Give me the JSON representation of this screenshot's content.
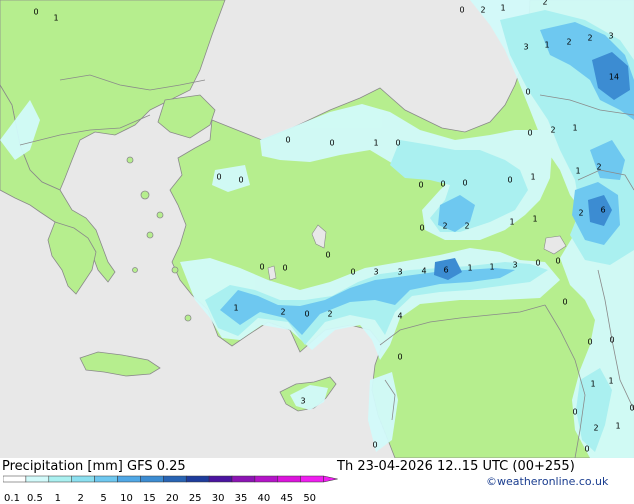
{
  "footer": {
    "title": "Precipitation [mm]  GFS 0.25",
    "valid": "Th 23-04-2026 12..15 UTC (00+255)",
    "credit": "©weatheronline.co.uk"
  },
  "legend": {
    "labels": [
      "0.1",
      "0.5",
      "1",
      "2",
      "5",
      "10",
      "15",
      "20",
      "25",
      "30",
      "35",
      "40",
      "45",
      "50"
    ],
    "colors": [
      "#ffffff",
      "#d2fafa",
      "#aaf0f0",
      "#8ce0f0",
      "#6ec8f0",
      "#50a8e6",
      "#3c8cd2",
      "#2864b4",
      "#1e3c9c",
      "#4b14a0",
      "#8c14b4",
      "#b414c8",
      "#dc14dc",
      "#f01ef0"
    ]
  },
  "map_colors": {
    "sea": "#e8e8e8",
    "land": "#b6ee8e",
    "border": "#8a8a8a",
    "precip_light": "#d2fafa",
    "precip_medium": "#aaf0f0",
    "precip_heavy": "#6ec8f0",
    "precip_max": "#3c8cd2"
  },
  "map_values": {
    "a0": "0",
    "a1": "1",
    "b0": "0",
    "b1": "2",
    "b2": "1",
    "b3": "2",
    "c0": "3",
    "c1": "1",
    "c2": "2",
    "c3": "2",
    "c4": "3",
    "d0": "14",
    "d1": "0",
    "e0": "0",
    "e1": "2",
    "e2": "1",
    "e3": "1",
    "e4": "2",
    "f0": "0",
    "f1": "0",
    "f2": "1",
    "f3": "0",
    "g0": "0",
    "g1": "0",
    "g2": "0",
    "g3": "0",
    "g4": "0",
    "g5": "1",
    "g6": "0",
    "h0": "0",
    "h1": "2",
    "h2": "2",
    "h3": "1",
    "h4": "1",
    "h5": "2",
    "h6": "6",
    "i0": "0",
    "i1": "0",
    "i2": "0",
    "i3": "3",
    "i4": "3",
    "i5": "4",
    "i6": "6",
    "i7": "1",
    "i8": "1",
    "i9": "3",
    "i10": "0",
    "i11": "0",
    "j0": "0",
    "j1": "1",
    "j2": "2",
    "j3": "0",
    "j4": "2",
    "j5": "4",
    "k0": "0",
    "k1": "0",
    "k2": "0",
    "k3": "0",
    "k4": "1",
    "l0": "3",
    "l1": "1",
    "l2": "0",
    "l3": "0",
    "l4": "2",
    "l5": "1",
    "l6": "0",
    "l7": "0"
  }
}
